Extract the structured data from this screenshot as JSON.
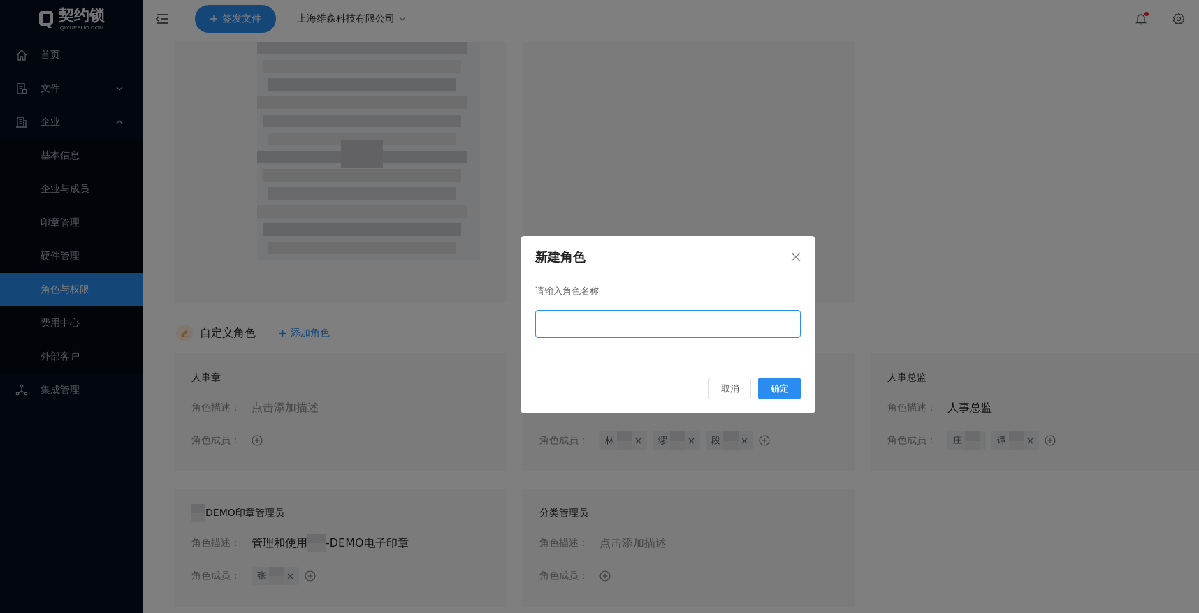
{
  "sidebar": {
    "logo": {
      "name": "契约锁",
      "domain": "QIYUESUO.COM"
    },
    "items": [
      {
        "label": "首页",
        "selected": false
      },
      {
        "label": "文件",
        "selected": false,
        "expanded": false
      },
      {
        "label": "企业",
        "selected": false,
        "expanded": true,
        "children": [
          {
            "label": "基本信息",
            "selected": false
          },
          {
            "label": "企业与成员",
            "selected": false
          },
          {
            "label": "印章管理",
            "selected": false
          },
          {
            "label": "硬件管理",
            "selected": false
          },
          {
            "label": "角色与权限",
            "selected": true
          },
          {
            "label": "费用中心",
            "selected": false
          },
          {
            "label": "外部客户",
            "selected": false
          }
        ]
      },
      {
        "label": "集成管理",
        "selected": false
      }
    ]
  },
  "header": {
    "send_button": "签发文件",
    "company": "上海维森科技有限公司",
    "notification_dot": true
  },
  "top_section": {
    "cards": [
      {
        "kind": "picture"
      },
      {
        "kind": "empty"
      }
    ]
  },
  "custom_roles": {
    "title": "自定义角色",
    "add_link": "添加角色",
    "roles": [
      {
        "title": [
          {
            "kind": "text",
            "text": "人事章"
          }
        ],
        "description_label": "角色描述：",
        "description": [
          {
            "kind": "placeholder",
            "text": "点击添加描述"
          }
        ],
        "members_label": "角色成员："
      },
      {
        "members_label": "角色成员：",
        "members": [
          {
            "name": "林",
            "removable": true
          },
          {
            "name": "缪",
            "removable": true
          },
          {
            "name": "段",
            "removable": true
          }
        ]
      },
      {
        "title": [
          {
            "kind": "text",
            "text": "人事总监"
          }
        ],
        "description_label": "角色描述：",
        "description": [
          {
            "kind": "text",
            "text": "人事总监"
          }
        ],
        "members_label": "角色成员：",
        "members": [
          {
            "name": "庄",
            "removable": false
          },
          {
            "name": "谭",
            "removable": true
          }
        ]
      },
      {
        "title": [
          {
            "kind": "redaction"
          },
          {
            "kind": "text",
            "text": "DEMO印章管理员"
          }
        ],
        "description_label": "角色描述：",
        "description": [
          {
            "kind": "text",
            "text": "管理和使用"
          },
          {
            "kind": "redaction"
          },
          {
            "kind": "text",
            "text": "-DEMO电子印章"
          }
        ],
        "members_label": "角色成员：",
        "members": [
          {
            "name": "张",
            "removable": true
          }
        ]
      },
      {
        "title": [
          {
            "kind": "text",
            "text": "分类管理员"
          }
        ],
        "description_label": "角色描述：",
        "description": [
          {
            "kind": "placeholder",
            "text": "点击添加描述"
          }
        ],
        "members_label": "角色成员："
      }
    ]
  },
  "modal": {
    "title": "新建角色",
    "label": "请输入角色名称",
    "focused": true,
    "buttons": [
      {
        "label": "取消",
        "kind": "default"
      },
      {
        "label": "确定",
        "kind": "primary"
      }
    ]
  }
}
